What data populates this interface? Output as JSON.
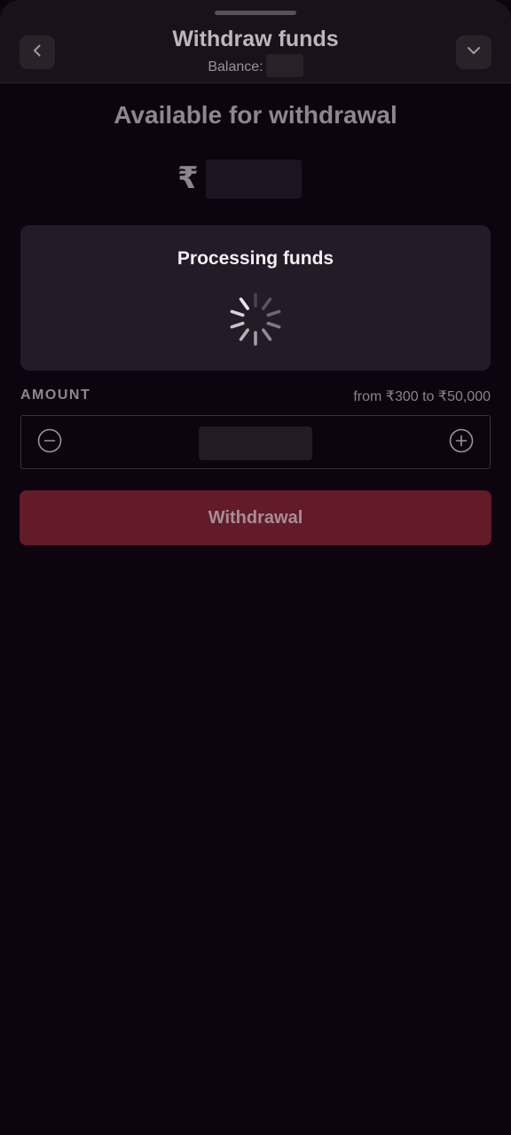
{
  "header": {
    "title": "Withdraw funds",
    "balance_label": "Balance:",
    "back_icon": "chevron-left-icon",
    "collapse_icon": "chevron-down-icon"
  },
  "available": {
    "title": "Available for withdrawal",
    "currency_symbol": "₹"
  },
  "processing": {
    "title": "Processing funds"
  },
  "amount": {
    "label": "AMOUNT",
    "range": "from ₹300 to ₹50,000",
    "minus_icon": "minus-circle-icon",
    "plus_icon": "plus-circle-icon"
  },
  "actions": {
    "withdraw_label": "Withdrawal"
  },
  "colors": {
    "background": "#0e0410",
    "header": "#1b111a",
    "card": "#241a28",
    "button": "#631b29"
  }
}
